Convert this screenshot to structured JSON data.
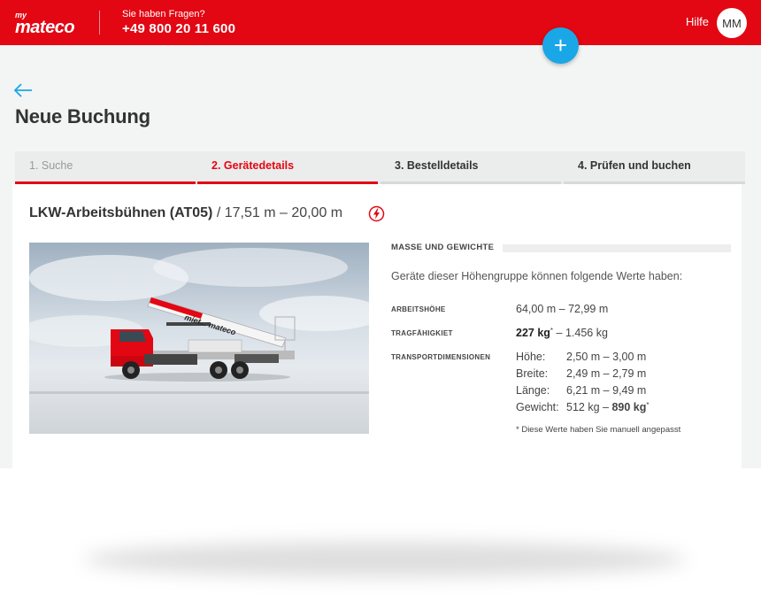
{
  "header": {
    "logo_my": "my",
    "logo_name": "mateco",
    "contact_label": "Sie haben Fragen?",
    "contact_phone": "+49 800 20 11 600",
    "help_label": "Hilfe",
    "user_initials": "MM"
  },
  "fab": {
    "label": "+"
  },
  "page": {
    "title": "Neue Buchung"
  },
  "steps": [
    {
      "label": "1. Suche",
      "state": "done"
    },
    {
      "label": "2. Gerätedetails",
      "state": "active"
    },
    {
      "label": "3. Bestelldetails",
      "state": "todo"
    },
    {
      "label": "4. Prüfen und buchen",
      "state": "todo"
    }
  ],
  "product": {
    "name": "LKW-Arbeitsbühnen (AT05)",
    "range": " / 17,51 m – 20,00 m",
    "photo_text": "miet... mateco"
  },
  "specs": {
    "section_title": "MASSE UND GEWICHTE",
    "intro": "Geräte dieser Höhengruppe können folgende Werte haben:",
    "arbeitshoehe_label": "ARBEITSHÖHE",
    "arbeitshoehe_value": "64,00 m – 72,99 m",
    "tragfaehigkeit_label": "TRAGFÄHIGKIET",
    "tragfaehigkeit_value": "227 kg",
    "tragfaehigkeit_mark": "*",
    "tragfaehigkeit_rest": " –  1.456 kg",
    "transport_label": "TRANSPORTDIMENSIONEN",
    "hoehe_key": "Höhe:",
    "hoehe_value": "2,50 m – 3,00 m",
    "breite_key": "Breite:",
    "breite_value": "2,49 m – 2,79 m",
    "laenge_key": "Länge:",
    "laenge_value": "6,21 m – 9,49 m",
    "gewicht_key": "Gewicht:",
    "gewicht_value_a": "512 kg – ",
    "gewicht_value_b": "890 kg",
    "gewicht_mark": "*",
    "footnote": "* Diese Werte haben Sie manuell angepasst"
  },
  "colors": {
    "brand_red": "#e30613",
    "fab_blue": "#1aa7e8",
    "accent_arrow": "#1aa7e8"
  },
  "icons": {
    "back": "arrow-left-icon",
    "power": "lightning-bolt-icon",
    "add": "plus-icon"
  }
}
